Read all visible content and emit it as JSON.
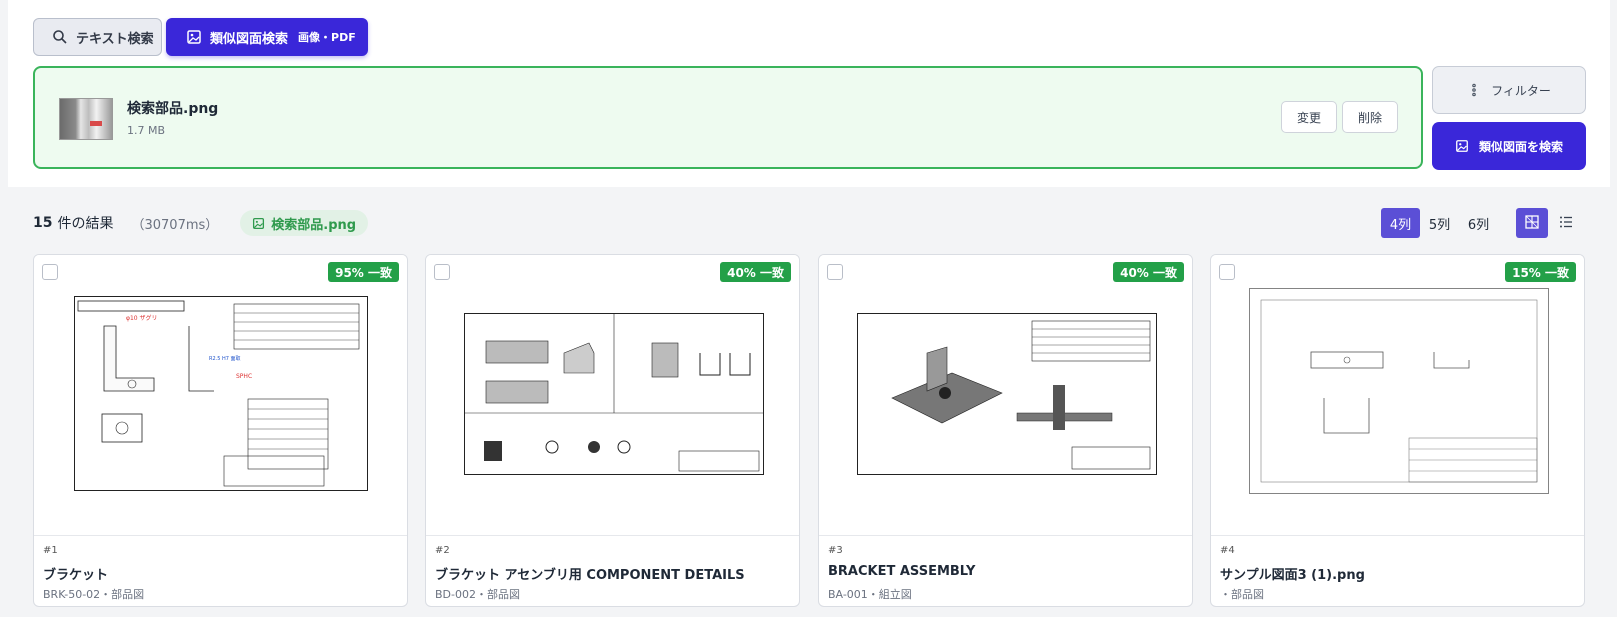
{
  "modes": {
    "text_search": "テキスト検索",
    "similar_search": "類似図面検索",
    "similar_sub": "画像・PDF"
  },
  "upload": {
    "file_name": "検索部品.png",
    "file_size": "1.7 MB",
    "change_label": "変更",
    "delete_label": "削除"
  },
  "actions": {
    "filter_label": "フィルター",
    "search_label": "類似図面を検索"
  },
  "results": {
    "count": "15",
    "count_label": "件の結果",
    "timing": "（30707ms）",
    "query_chip": "検索部品.png"
  },
  "columns": {
    "c4": "4列",
    "c5": "5列",
    "c6": "6列",
    "selected": "4列"
  },
  "cards": [
    {
      "match": "95% 一致",
      "num": "#1",
      "title": "ブラケット",
      "sub": "BRK-50-02・部品図"
    },
    {
      "match": "40% 一致",
      "num": "#2",
      "title": "ブラケット アセンブリ用 COMPONENT DETAILS",
      "sub": "BD-002・部品図"
    },
    {
      "match": "40% 一致",
      "num": "#3",
      "title": "BRACKET ASSEMBLY",
      "sub": "BA-001・組立図"
    },
    {
      "match": "15% 一致",
      "num": "#4",
      "title": "サンプル図面3 (1).png",
      "sub": "・部品図"
    }
  ],
  "colors": {
    "accent": "#3a27d9",
    "success": "#23a048",
    "upload_border": "#3ab45b"
  },
  "icons": [
    "search-icon",
    "image-icon",
    "filter-icon",
    "grid-view-icon",
    "list-view-icon"
  ]
}
